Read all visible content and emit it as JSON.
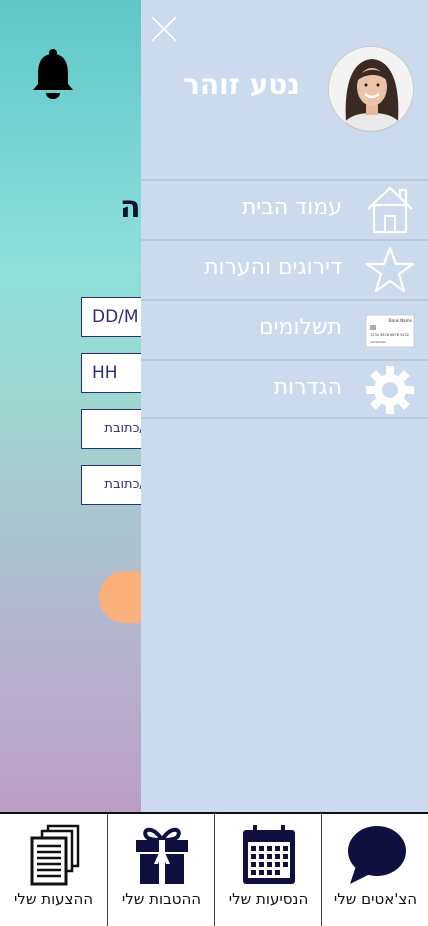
{
  "background": {
    "heading_fragment": "ה",
    "fields": [
      {
        "value": "DD/M"
      },
      {
        "value": "HH"
      },
      {
        "value": "ום/כתובת"
      },
      {
        "value": "ום/כתובת"
      }
    ],
    "icons": {
      "bell": "bell-icon"
    }
  },
  "drawer": {
    "user_name": "נטע זוהר",
    "menu": [
      {
        "label": "עמוד הבית",
        "icon": "home-icon"
      },
      {
        "label": "דירוגים והערות",
        "icon": "star-icon"
      },
      {
        "label": "תשלומים",
        "icon": "credit-card-icon"
      },
      {
        "label": "הגדרות",
        "icon": "gear-icon"
      }
    ],
    "card_text": {
      "bank_name": "Bank Name",
      "number": "1234 5678 9876 5432",
      "holder": "cardholder"
    }
  },
  "tabbar": {
    "tabs": [
      {
        "label": "ההצעות שלי",
        "icon": "documents-icon"
      },
      {
        "label": "ההטבות שלי",
        "icon": "gift-icon"
      },
      {
        "label": "הנסיעות שלי",
        "icon": "calendar-icon"
      },
      {
        "label": "הצ'אטים שלי",
        "icon": "chat-bubble-icon"
      }
    ]
  },
  "colors": {
    "drawer_bg": "#cbdbed",
    "accent_navy": "#101040",
    "button_orange": "#f9b07a"
  }
}
